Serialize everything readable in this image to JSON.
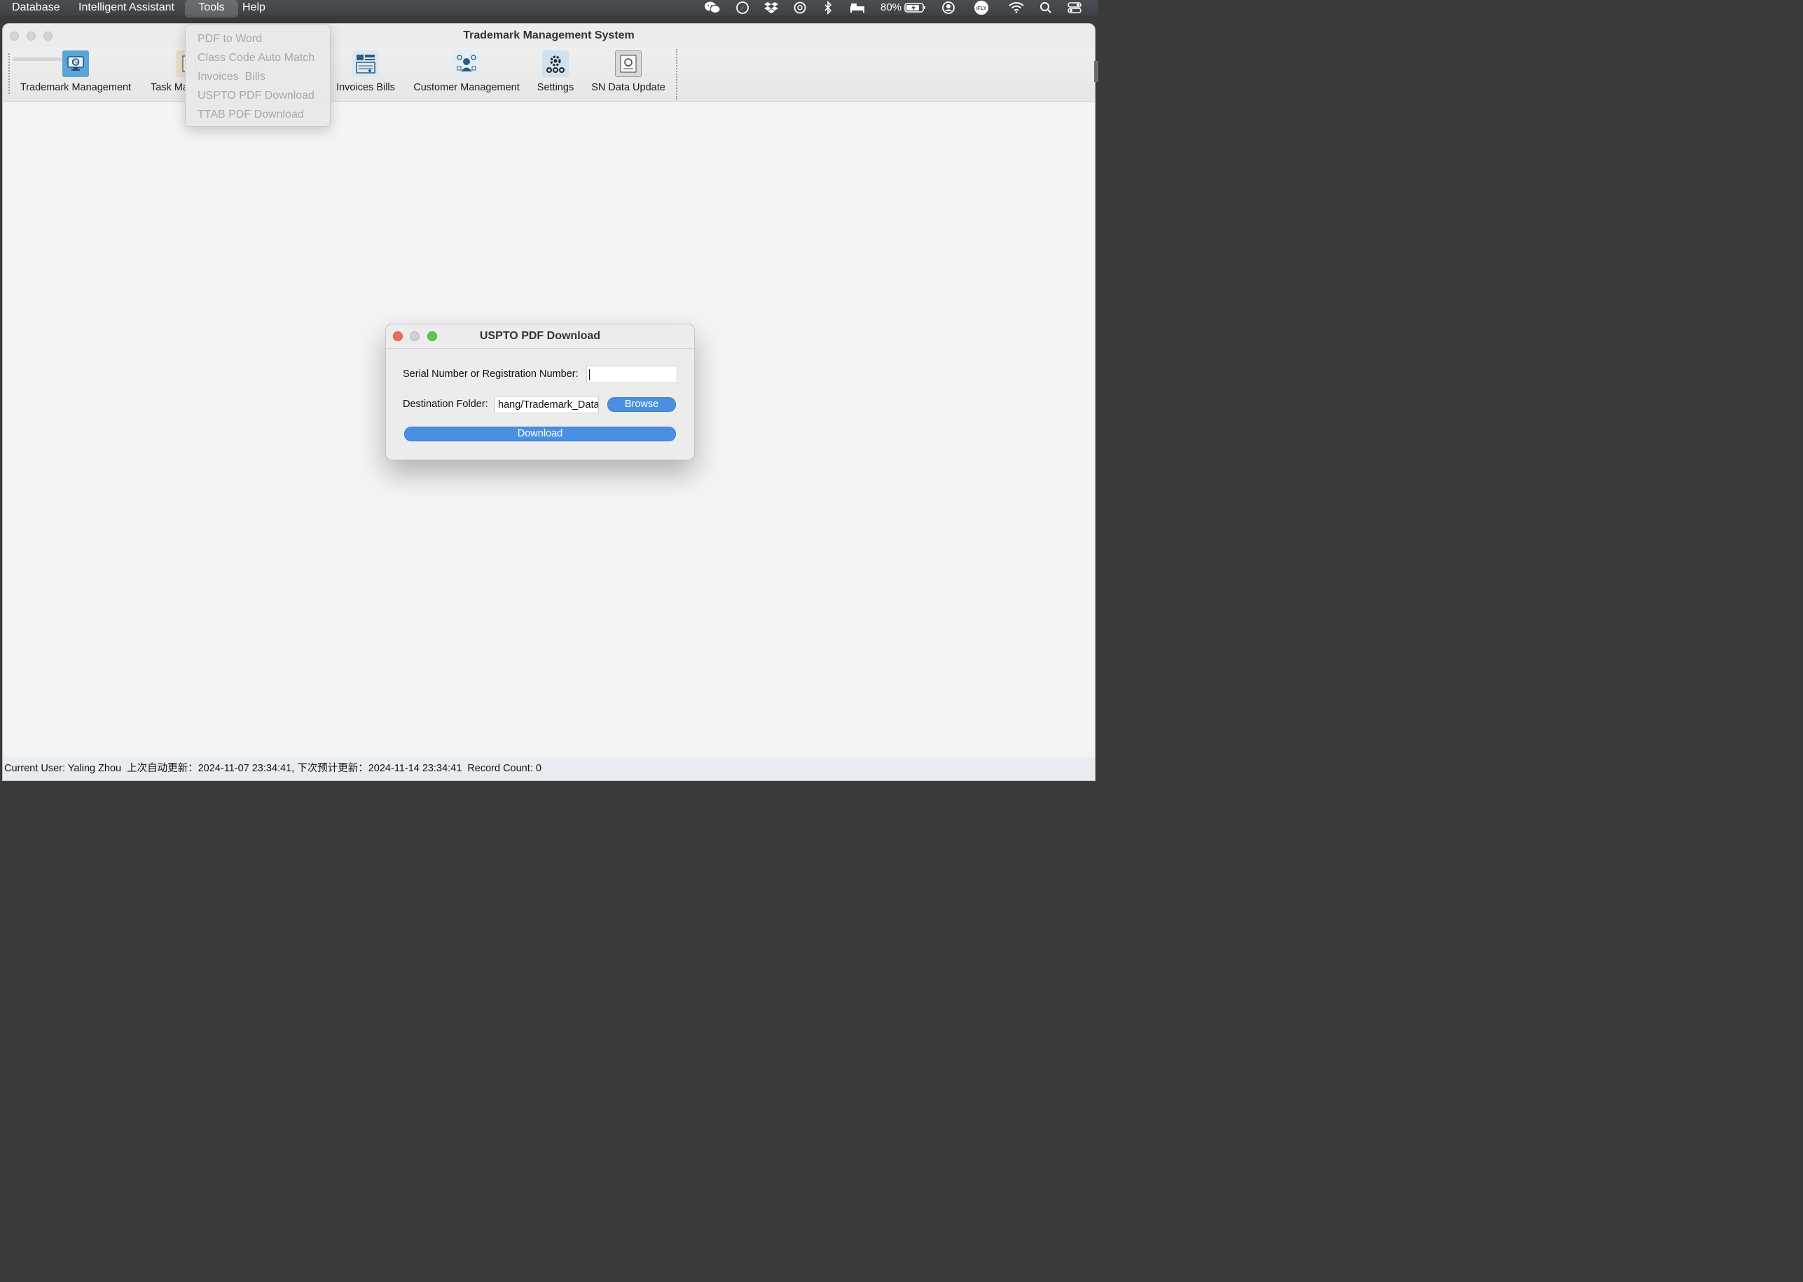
{
  "menubar": {
    "items": [
      "Database",
      "Intelligent Assistant",
      "Tools",
      "Help"
    ],
    "active": "Tools",
    "battery": "80%"
  },
  "window": {
    "title": "Trademark Management System"
  },
  "toolbar": {
    "items": [
      {
        "label": "Trademark Management",
        "icon": "trademark-monitor-icon"
      },
      {
        "label": "Task Ma",
        "icon": "task-icon"
      },
      {
        "label": "Invoices  Bills",
        "icon": "invoice-icon"
      },
      {
        "label": "Customer Management",
        "icon": "customer-icon"
      },
      {
        "label": "Settings",
        "icon": "settings-gear-icon"
      },
      {
        "label": "SN Data Update",
        "icon": "data-update-icon"
      }
    ]
  },
  "tools_menu": {
    "items": [
      "PDF to Word",
      "Class Code Auto Match",
      "Invoices  Bills",
      "USPTO PDF Download",
      "TTAB PDF Download"
    ]
  },
  "dialog": {
    "title": "USPTO PDF Download",
    "serial_label": "Serial Number or Registration Number:",
    "serial_value": "",
    "dest_label": "Destination Folder:",
    "dest_value": "hang/Trademark_Data",
    "browse_label": "Browse",
    "download_label": "Download"
  },
  "statusbar": {
    "user": "Current User: Yaling Zhou",
    "update_info": "上次自动更新：2024-11-07 23:34:41, 下次预计更新：2024-11-14 23:34:41",
    "record_count": "Record Count: 0"
  },
  "colors": {
    "accent_blue": "#4a90e2",
    "close_red": "#ed6a5e",
    "minimize_gray": "#d0d0d0",
    "zoom_green": "#61c554"
  }
}
